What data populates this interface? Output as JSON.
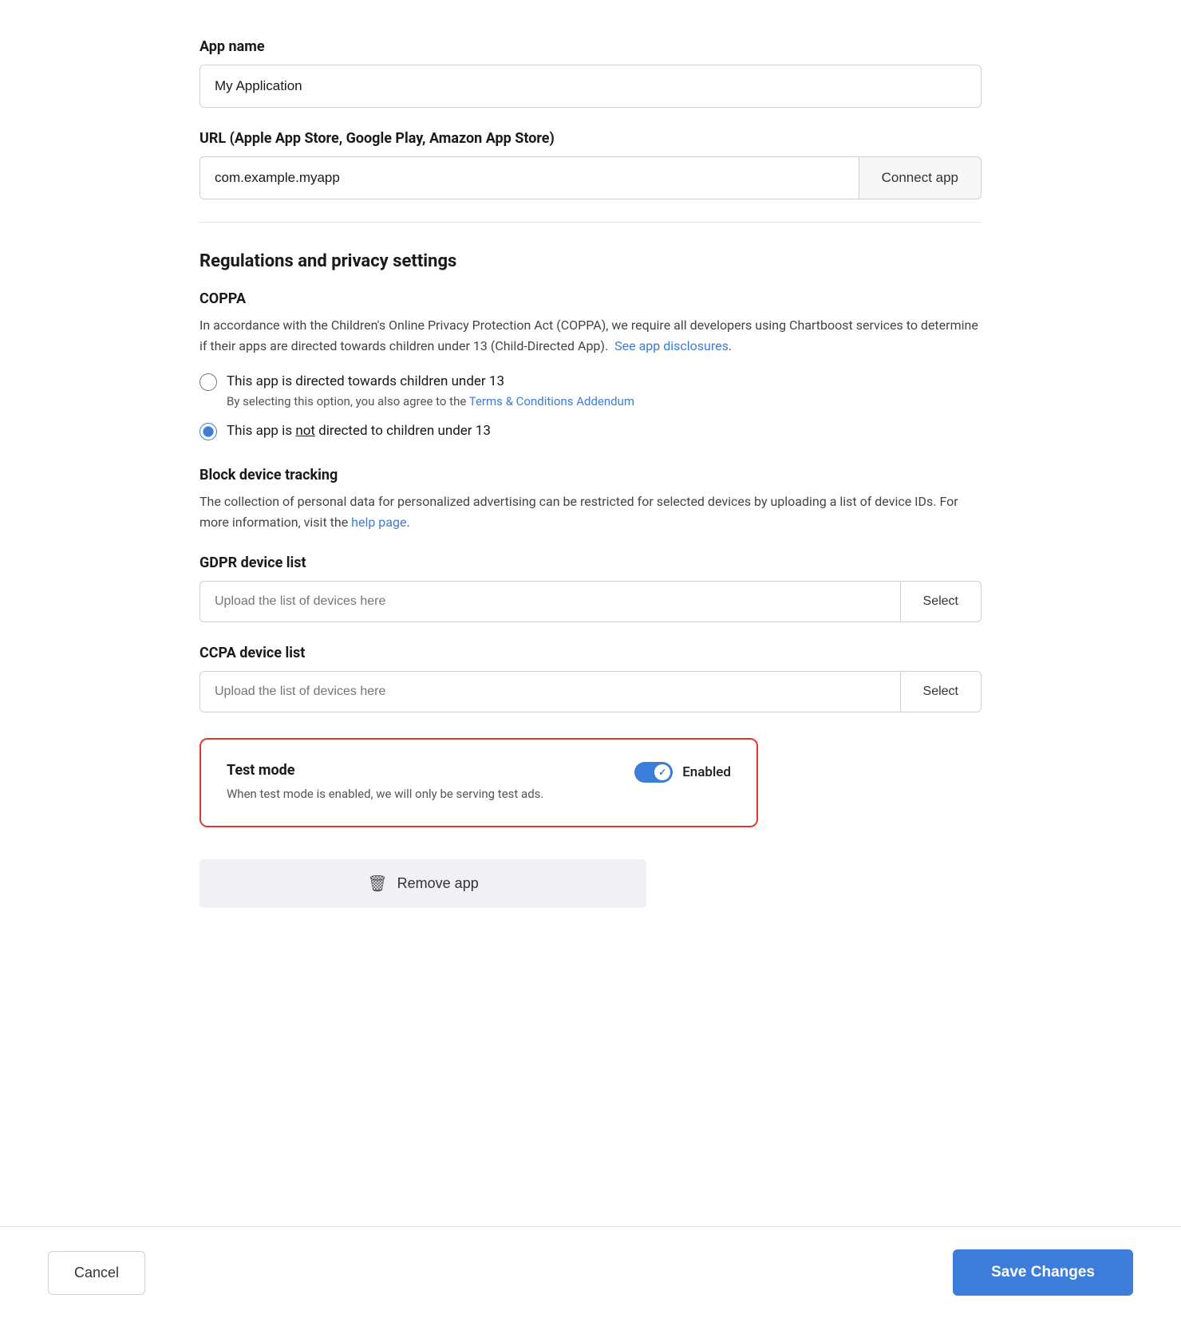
{
  "appName": {
    "label": "App name",
    "value": "My Application",
    "placeholder": "My Application"
  },
  "urlField": {
    "label": "URL (Apple App Store, Google Play, Amazon App Store)",
    "value": "com.example.myapp",
    "placeholder": "com.example.myapp",
    "connectButton": "Connect app"
  },
  "regulations": {
    "sectionTitle": "Regulations and privacy settings",
    "coppa": {
      "title": "COPPA",
      "description1": "In accordance with the Children's Online Privacy Protection Act (COPPA), we require all developers using Chartboost services to determine if their apps are directed towards children under 13 (Child-Directed App).",
      "linkText": "See app disclosures",
      "description2": ".",
      "option1": {
        "label": "This app is directed towards children under 13",
        "subLabel": "By selecting this option, you also agree to the ",
        "subLinkText": "Terms & Conditions Addendum",
        "checked": false
      },
      "option2": {
        "label1": "This app is ",
        "notText": "not",
        "label2": " directed to children under 13",
        "checked": true
      }
    },
    "blockTracking": {
      "title": "Block device tracking",
      "description": "The collection of personal data for personalized advertising can be restricted for selected devices by uploading a list of device IDs. For more information, visit the ",
      "linkText": "help page",
      "descriptionEnd": "."
    },
    "gdpr": {
      "label": "GDPR device list",
      "placeholder": "Upload the list of devices here",
      "selectButton": "Select"
    },
    "ccpa": {
      "label": "CCPA device list",
      "placeholder": "Upload the list of devices here",
      "selectButton": "Select"
    }
  },
  "testMode": {
    "title": "Test mode",
    "description": "When test mode is enabled, we will only be serving test ads.",
    "toggleLabel": "Enabled",
    "enabled": true
  },
  "removeApp": {
    "label": "Remove app"
  },
  "footer": {
    "cancelLabel": "Cancel",
    "saveLabel": "Save Changes"
  }
}
